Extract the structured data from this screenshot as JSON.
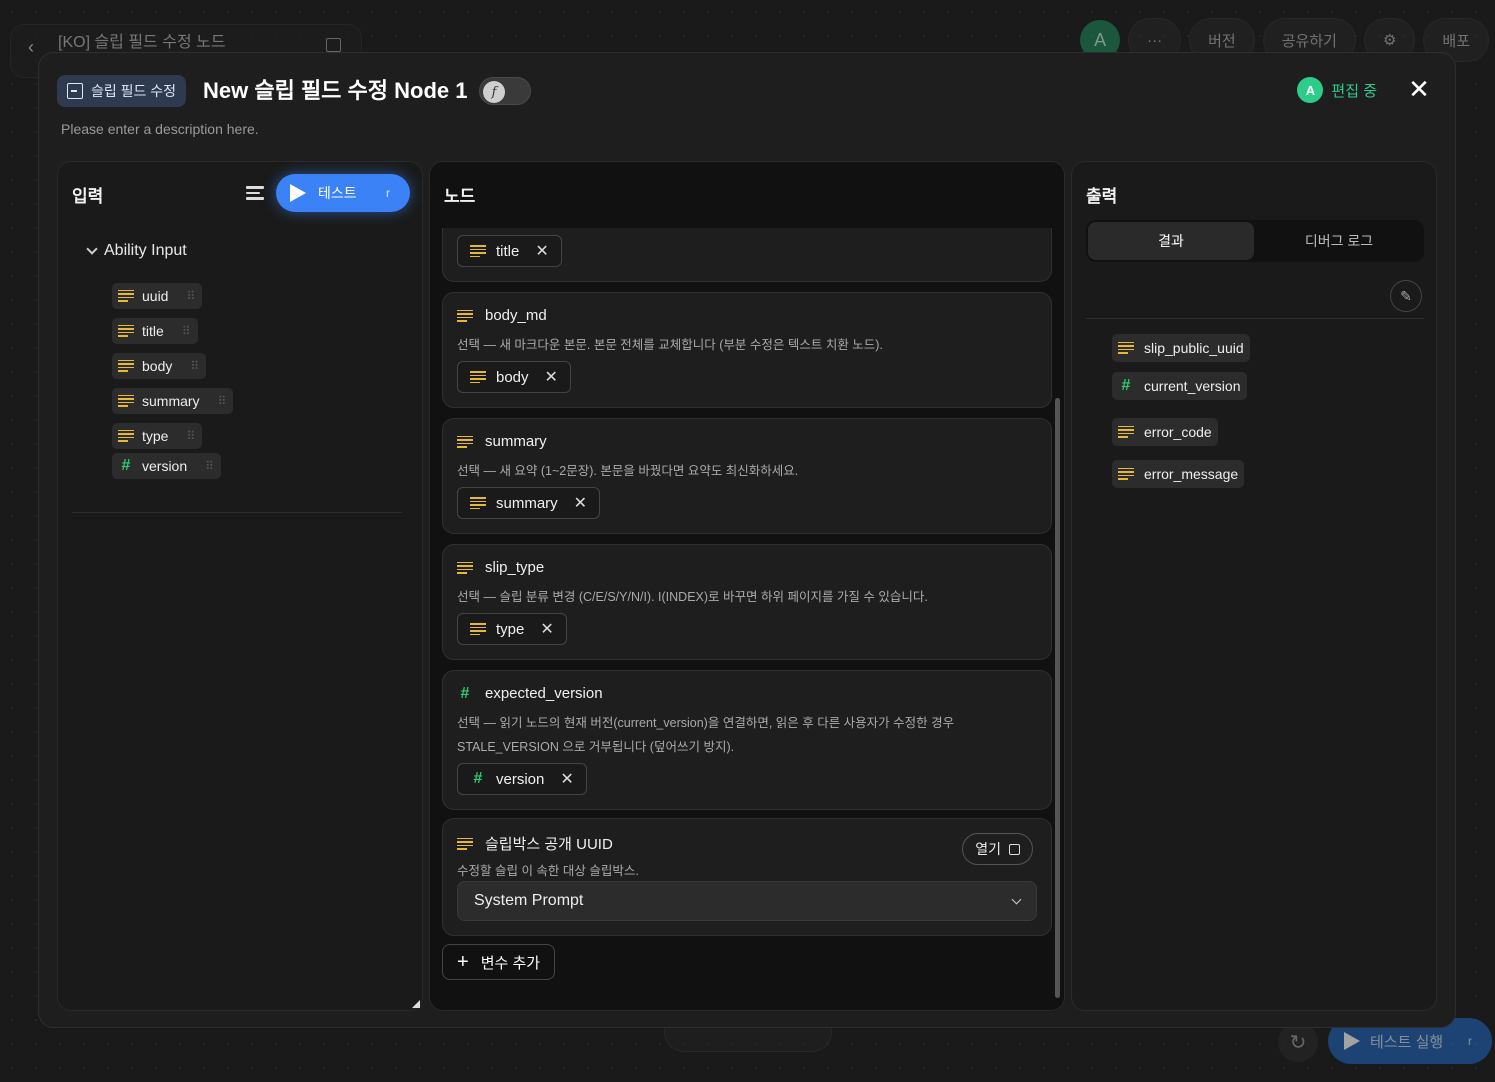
{
  "topbar": {
    "doc_title": "[KO] 슬립 필드 수정 노드",
    "avatar": "A",
    "more": "···",
    "version": "버전",
    "share": "공유하기",
    "deploy": "배포"
  },
  "bottom": {
    "run_label": "테스트 실행",
    "run_key": "r"
  },
  "modal": {
    "badge": "슬립 필드 수정",
    "title": "New 슬립 필드 수정 Node 1",
    "toggle_glyph": "f",
    "description": "Please enter a description here.",
    "editing_avatar": "A",
    "editing_label": "편집 중",
    "close": "✕"
  },
  "input_panel": {
    "title": "입력",
    "test_label": "테스트",
    "test_key": "r",
    "group": "Ability Input",
    "items": [
      {
        "label": "uuid",
        "kind": "text"
      },
      {
        "label": "title",
        "kind": "text"
      },
      {
        "label": "body",
        "kind": "text"
      },
      {
        "label": "summary",
        "kind": "text"
      },
      {
        "label": "type",
        "kind": "text"
      },
      {
        "label": "version",
        "kind": "number"
      }
    ]
  },
  "node_panel": {
    "title": "노드",
    "top_chip": "title",
    "cards": [
      {
        "label": "body_md",
        "kind": "text",
        "desc": "선택 — 새 마크다운 본문. 본문 전체를 교체합니다 (부분 수정은 텍스트 치환 노드).",
        "chip": "body",
        "chip_kind": "text"
      },
      {
        "label": "summary",
        "kind": "text",
        "desc": "선택 — 새 요약 (1~2문장). 본문을 바꿨다면 요약도 최신화하세요.",
        "chip": "summary",
        "chip_kind": "text"
      },
      {
        "label": "slip_type",
        "kind": "text",
        "desc": "선택 — 슬립 분류 변경 (C/E/S/Y/N/I). I(INDEX)로 바꾸면 하위 페이지를 가질 수 있습니다.",
        "chip": "type",
        "chip_kind": "text"
      },
      {
        "label": "expected_version",
        "kind": "number",
        "desc": "선택 — 읽기 노드의 현재 버전(current_version)을 연결하면, 읽은 후 다른 사용자가 수정한 경우 STALE_VERSION 으로 거부됩니다 (덮어쓰기 방지).",
        "chip": "version",
        "chip_kind": "number"
      }
    ],
    "uuid_card": {
      "label": "슬립박스 공개 UUID",
      "desc": "수정할 슬립 이 속한 대상 슬립박스.",
      "open": "열기",
      "select_value": "System Prompt"
    },
    "add_var": "변수 추가"
  },
  "output_panel": {
    "title": "출력",
    "tab_result": "결과",
    "tab_debug": "디버그 로그",
    "items": [
      {
        "label": "slip_public_uuid",
        "kind": "text"
      },
      {
        "label": "current_version",
        "kind": "number"
      },
      {
        "label": "error_code",
        "kind": "text"
      },
      {
        "label": "error_message",
        "kind": "text"
      }
    ]
  },
  "colors": {
    "accent": "#3b82f6",
    "text_icon": "#e5b83a",
    "number_icon": "#2ecc71",
    "editing": "#2ecc8a"
  }
}
